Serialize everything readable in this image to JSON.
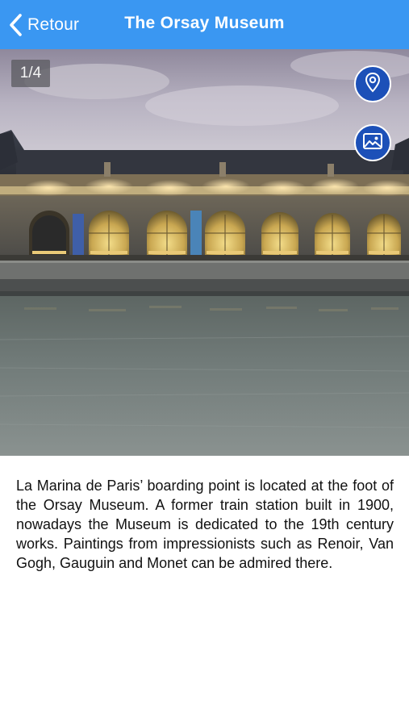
{
  "navbar": {
    "back_label": "Retour",
    "title": "The Orsay Museum"
  },
  "gallery": {
    "counter": "1/4"
  },
  "icons": {
    "back": "chevron-left-icon",
    "location": "map-pin-icon",
    "gallery": "image-gallery-icon"
  },
  "colors": {
    "navbar": "#3a97f2",
    "fab": "#1c50b8",
    "text": "#111111"
  },
  "description": "La Marina de Paris’ boarding point is located at the foot of the Orsay Museum.  A former train station built in 1900, nowadays the Museum is dedicated to the 19th century works. Paintings from impressionists such as Renoir, Van Gogh, Gauguin and Monet can be admired there."
}
